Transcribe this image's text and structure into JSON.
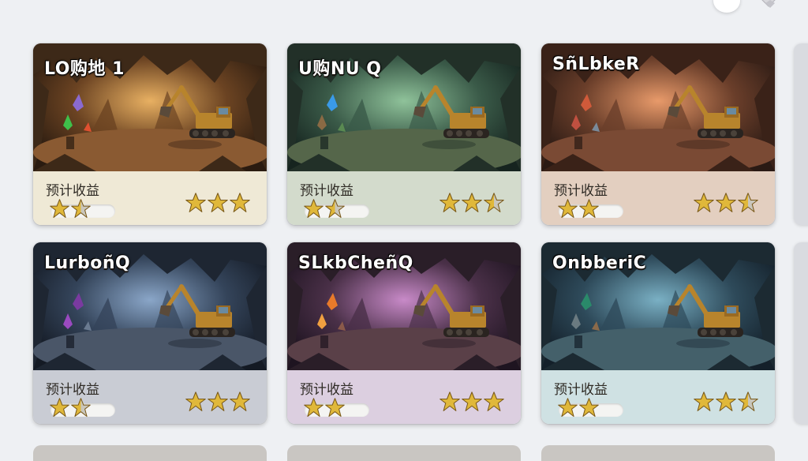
{
  "top_bar": {
    "profile_icon": "avatar-circle",
    "gem_icon": "gem-icon"
  },
  "cards": [
    {
      "title": "LO购地 1",
      "revenue_label": "预计收益",
      "rating_left": 1.5,
      "rating_right": 3,
      "theme": "amber",
      "panel_color": "#efe9d6"
    },
    {
      "title": "U购NU Q",
      "revenue_label": "预计收益",
      "rating_left": 1.5,
      "rating_right": 2.5,
      "theme": "green",
      "panel_color": "#d3dbcc"
    },
    {
      "title": "SñLbkeR",
      "revenue_label": "预计收益",
      "rating_left": 2.5,
      "rating_right": 2.5,
      "theme": "copper",
      "panel_color": "#e3cfc0"
    },
    {
      "title": "LurboñQ",
      "revenue_label": "预计收益",
      "rating_left": 1.5,
      "rating_right": 3,
      "theme": "slate",
      "panel_color": "#c9ccd4"
    },
    {
      "title": "SLkbCheñQ",
      "revenue_label": "预计收益",
      "rating_left": 2.5,
      "rating_right": 3,
      "theme": "purple",
      "panel_color": "#dccfe0"
    },
    {
      "title": "OnbberiC",
      "revenue_label": "预计收益",
      "rating_left": 2.5,
      "rating_right": 2.5,
      "theme": "teal",
      "panel_color": "#cfe1e3"
    }
  ]
}
